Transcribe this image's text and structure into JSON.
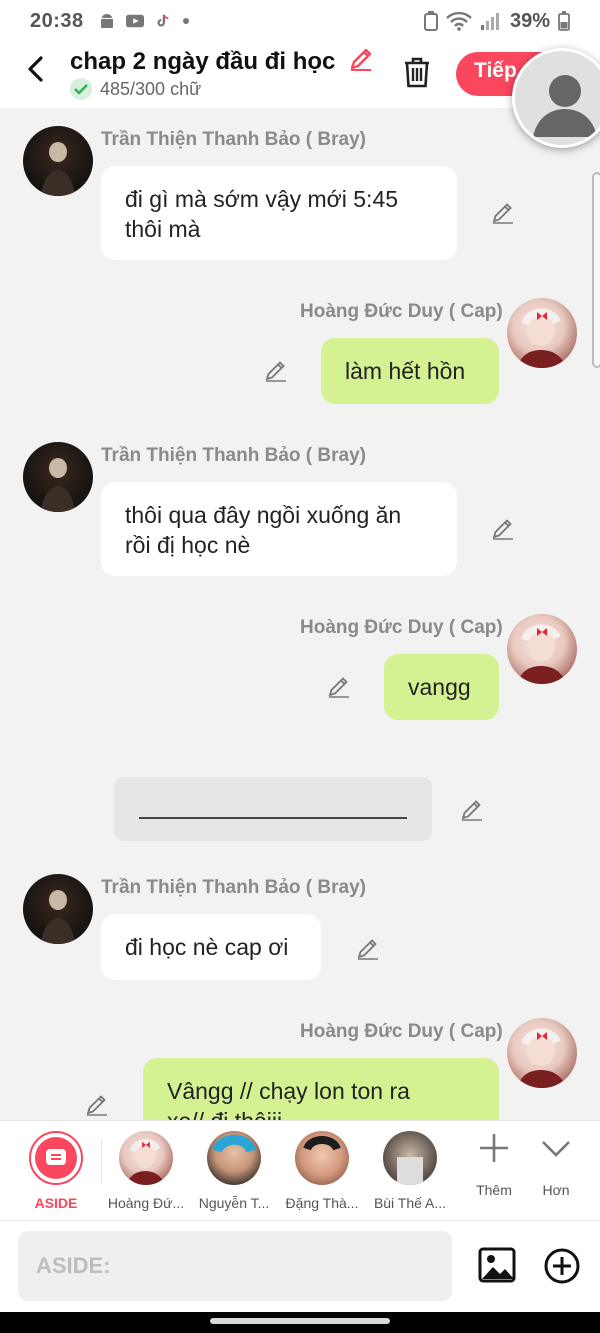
{
  "status_bar": {
    "time": "20:38",
    "battery": "39%"
  },
  "header": {
    "title": "chap 2 ngày đầu đi học",
    "word_count": "485/300 chữ",
    "next_button": "Tiếp"
  },
  "messages": [
    {
      "sender": "Trần Thiện Thanh Bảo ( Bray)",
      "side": "left",
      "lines": [
        "đi gì mà sớm vậy mới 5:45",
        "thôi mà"
      ]
    },
    {
      "sender": "Hoàng Đức Duy ( Cap)",
      "side": "right",
      "lines": [
        "làm hết hồn"
      ]
    },
    {
      "sender": "Trần Thiện Thanh Bảo ( Bray)",
      "side": "left",
      "lines": [
        "thôi qua đây ngồi xuống ăn",
        "rồi đị học nè"
      ]
    },
    {
      "sender": "Hoàng Đức Duy ( Cap)",
      "side": "right",
      "lines": [
        "vangg"
      ]
    },
    {
      "sender": "Trần Thiện Thanh Bảo ( Bray)",
      "side": "left",
      "lines": [
        "đi học nè cap ơi"
      ]
    },
    {
      "sender": "Hoàng Đức Duy ( Cap)",
      "side": "right",
      "lines": [
        "Vângg // chạy lon ton ra",
        "xe// đi thôiii"
      ]
    }
  ],
  "characters": [
    {
      "label": "ASIDE"
    },
    {
      "label": "Hoàng Đứ..."
    },
    {
      "label": "Nguyễn T..."
    },
    {
      "label": "Đặng Thà..."
    },
    {
      "label": "Bùi Thế A..."
    }
  ],
  "more_actions": {
    "add_label": "Thêm",
    "more_label": "Hơn"
  },
  "input": {
    "placeholder": "ASIDE:"
  },
  "colors": {
    "accent": "#f9475e",
    "green_bubble": "#d4f291"
  }
}
